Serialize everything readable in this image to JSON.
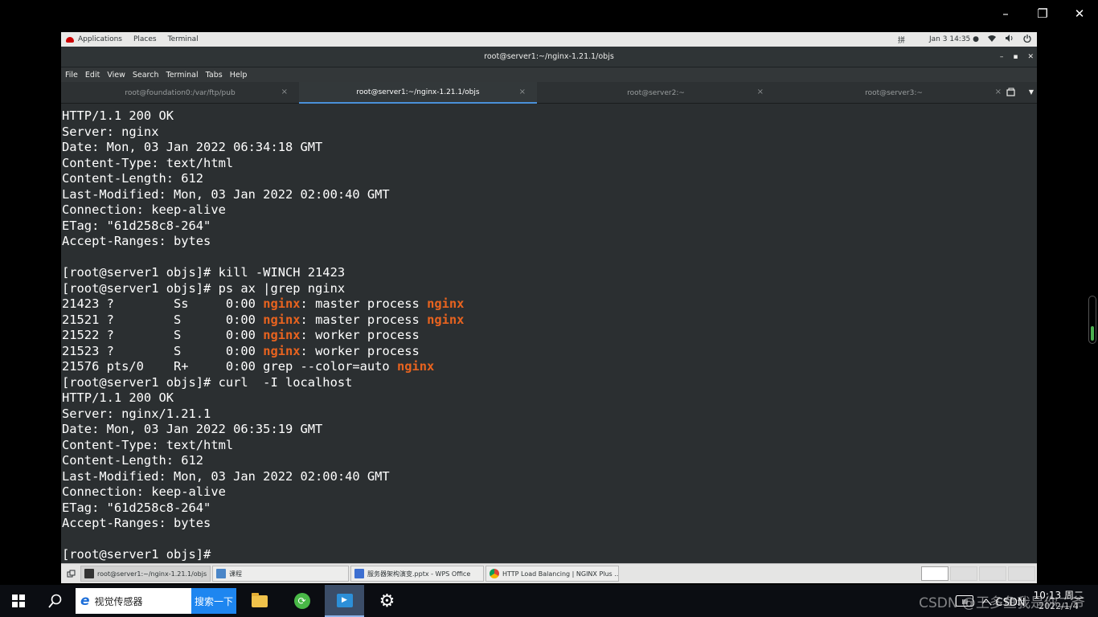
{
  "player": {
    "minimize": "–",
    "restore": "❐",
    "close": "✕"
  },
  "gnome_bar": {
    "applications": "Applications",
    "places": "Places",
    "terminal": "Terminal",
    "input_method": "拼",
    "clock": "Jan 3  14:35 ●"
  },
  "window": {
    "title": "root@server1:~/nginx-1.21.1/objs",
    "min": "–",
    "max": "▪",
    "close": "✕"
  },
  "menubar": [
    "File",
    "Edit",
    "View",
    "Search",
    "Terminal",
    "Tabs",
    "Help"
  ],
  "tabs": [
    {
      "label": "root@foundation0:/var/ftp/pub",
      "active": false
    },
    {
      "label": "root@server1:~/nginx-1.21.1/objs",
      "active": true
    },
    {
      "label": "root@server2:~",
      "active": false
    },
    {
      "label": "root@server3:~",
      "active": false
    }
  ],
  "tab_close": "×",
  "terminal": {
    "highlight_color": "#e8631f",
    "lines": [
      [
        {
          "t": "HTTP/1.1 200 OK"
        }
      ],
      [
        {
          "t": "Server: nginx"
        }
      ],
      [
        {
          "t": "Date: Mon, 03 Jan 2022 06:34:18 GMT"
        }
      ],
      [
        {
          "t": "Content-Type: text/html"
        }
      ],
      [
        {
          "t": "Content-Length: 612"
        }
      ],
      [
        {
          "t": "Last-Modified: Mon, 03 Jan 2022 02:00:40 GMT"
        }
      ],
      [
        {
          "t": "Connection: keep-alive"
        }
      ],
      [
        {
          "t": "ETag: \"61d258c8-264\""
        }
      ],
      [
        {
          "t": "Accept-Ranges: bytes"
        }
      ],
      [
        {
          "t": ""
        }
      ],
      [
        {
          "t": "[root@server1 objs]# kill -WINCH 21423"
        }
      ],
      [
        {
          "t": "[root@server1 objs]# ps ax |grep nginx"
        }
      ],
      [
        {
          "t": "21423 ?        Ss     0:00 "
        },
        {
          "t": "nginx",
          "hl": true
        },
        {
          "t": ": master process "
        },
        {
          "t": "nginx",
          "hl": true
        }
      ],
      [
        {
          "t": "21521 ?        S      0:00 "
        },
        {
          "t": "nginx",
          "hl": true
        },
        {
          "t": ": master process "
        },
        {
          "t": "nginx",
          "hl": true
        }
      ],
      [
        {
          "t": "21522 ?        S      0:00 "
        },
        {
          "t": "nginx",
          "hl": true
        },
        {
          "t": ": worker process"
        }
      ],
      [
        {
          "t": "21523 ?        S      0:00 "
        },
        {
          "t": "nginx",
          "hl": true
        },
        {
          "t": ": worker process"
        }
      ],
      [
        {
          "t": "21576 pts/0    R+     0:00 grep --color=auto "
        },
        {
          "t": "nginx",
          "hl": true
        }
      ],
      [
        {
          "t": "[root@server1 objs]# curl  -I localhost"
        }
      ],
      [
        {
          "t": "HTTP/1.1 200 OK"
        }
      ],
      [
        {
          "t": "Server: nginx/1.21.1"
        }
      ],
      [
        {
          "t": "Date: Mon, 03 Jan 2022 06:35:19 GMT"
        }
      ],
      [
        {
          "t": "Content-Type: text/html"
        }
      ],
      [
        {
          "t": "Content-Length: 612"
        }
      ],
      [
        {
          "t": "Last-Modified: Mon, 03 Jan 2022 02:00:40 GMT"
        }
      ],
      [
        {
          "t": "Connection: keep-alive"
        }
      ],
      [
        {
          "t": "ETag: \"61d258c8-264\""
        }
      ],
      [
        {
          "t": "Accept-Ranges: bytes"
        }
      ],
      [
        {
          "t": ""
        }
      ],
      [
        {
          "t": "[root@server1 objs]#"
        }
      ]
    ]
  },
  "window_list": [
    {
      "label": "root@server1:~/nginx-1.21.1/objs",
      "icon_color": "#333333",
      "active": true
    },
    {
      "label": "课程",
      "icon_color": "#4a86c8",
      "active": false
    },
    {
      "label": "服务器架构演变.pptx - WPS Office",
      "icon_color": "#3d6fd1",
      "active": false
    },
    {
      "label": "HTTP Load Balancing | NGINX Plus ...",
      "icon_color": "#e0a125",
      "active": false
    }
  ],
  "host_taskbar": {
    "search_text": "视觉传感器",
    "search_button": "搜索一下",
    "tray_text": "へ CSDN",
    "time": "10:13 周二",
    "date": "2022/1/4"
  },
  "watermark": "CSDN @王多鱼我是你二爷"
}
